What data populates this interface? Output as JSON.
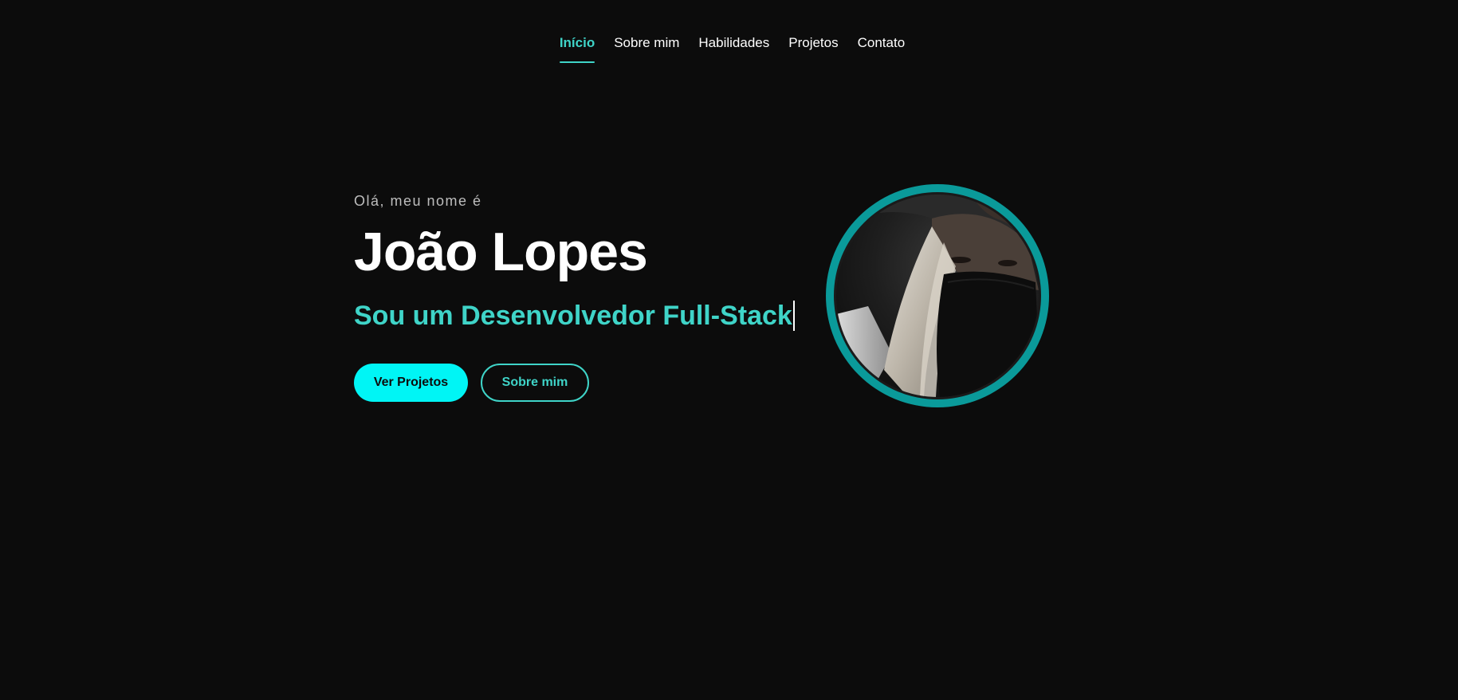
{
  "nav": {
    "items": [
      {
        "label": "Início",
        "active": true
      },
      {
        "label": "Sobre mim",
        "active": false
      },
      {
        "label": "Habilidades",
        "active": false
      },
      {
        "label": "Projetos",
        "active": false
      },
      {
        "label": "Contato",
        "active": false
      }
    ]
  },
  "hero": {
    "greeting": "Olá, meu nome é",
    "name": "João Lopes",
    "role": "Sou um Desenvolvedor Full-Stack",
    "primary_button": "Ver Projetos",
    "secondary_button": "Sobre mim"
  },
  "colors": {
    "background": "#0c0c0c",
    "accent": "#3fd4c8",
    "primary_button": "#00f5f5",
    "avatar_ring": "#0a9a9a"
  }
}
